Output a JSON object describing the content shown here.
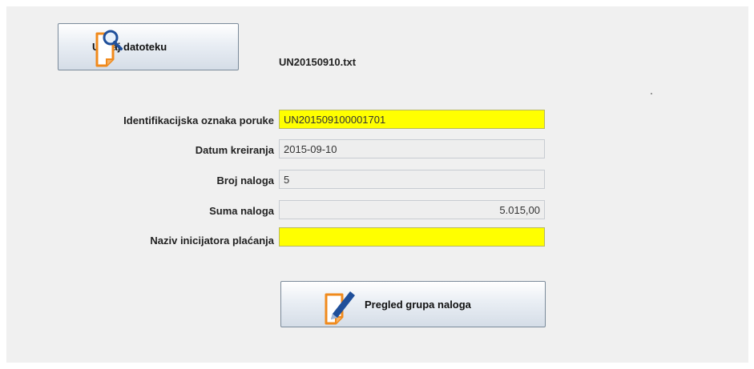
{
  "toolbar": {
    "load_button_label": "Učitaj datoteku",
    "load_icon": "document-search-icon",
    "file_name": "UN20150910.txt"
  },
  "form": {
    "fields": [
      {
        "label": "Identifikacijska oznaka poruke",
        "value": "UN201509100001701"
      },
      {
        "label": "Datum kreiranja",
        "value": "2015-09-10"
      },
      {
        "label": "Broj naloga",
        "value": "5"
      },
      {
        "label": "Suma naloga",
        "value": "5.015,00"
      },
      {
        "label": "Naziv inicijatora plaćanja",
        "value": ""
      }
    ]
  },
  "actions": {
    "view_button_label": "Pregled grupa naloga",
    "view_icon": "document-edit-icon"
  },
  "colors": {
    "highlight": "#ffff00",
    "icon_orange": "#f08a1c",
    "icon_blue": "#1f4f9a"
  }
}
